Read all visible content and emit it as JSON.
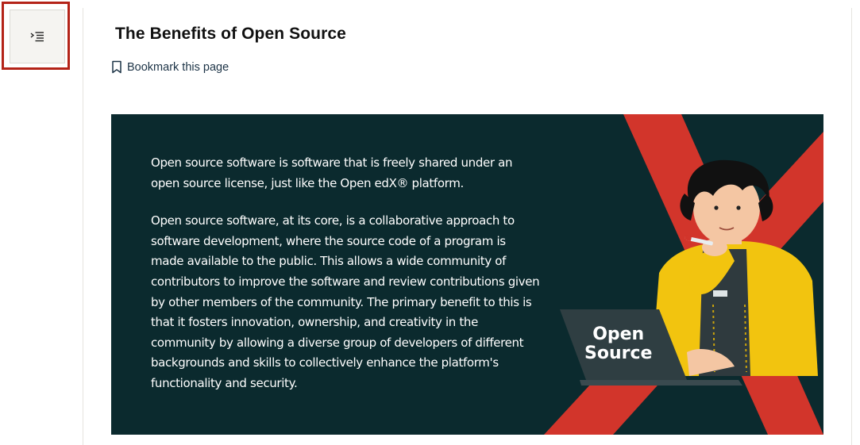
{
  "sidebar": {
    "toggle_icon": "outline-list-indent-icon",
    "highlight_color": "#b42318"
  },
  "unit": {
    "title": "The Benefits of Open Source",
    "bookmark_label": "Bookmark this page",
    "bookmark_icon": "bookmark-outline-icon"
  },
  "hero": {
    "background_color": "#0b2a2e",
    "accent_color": "#d2352b",
    "paragraphs": [
      "Open source software is software that is freely shared under an open source license, just like the Open edX® platform.",
      "Open source software, at its core, is a collaborative approach to software development, where the source code of a program is made available to the public. This allows a wide community of contributors to improve the software and review contributions given by other members of the community. The primary benefit to this is that it fosters innovation, ownership, and creativity in the community by allowing a diverse group of developers of different backgrounds and skills to collectively enhance the platform's functionality and security."
    ],
    "laptop_label_line1": "Open",
    "laptop_label_line2": "Source",
    "illustration": "person-thinking-with-laptop-illustration"
  }
}
